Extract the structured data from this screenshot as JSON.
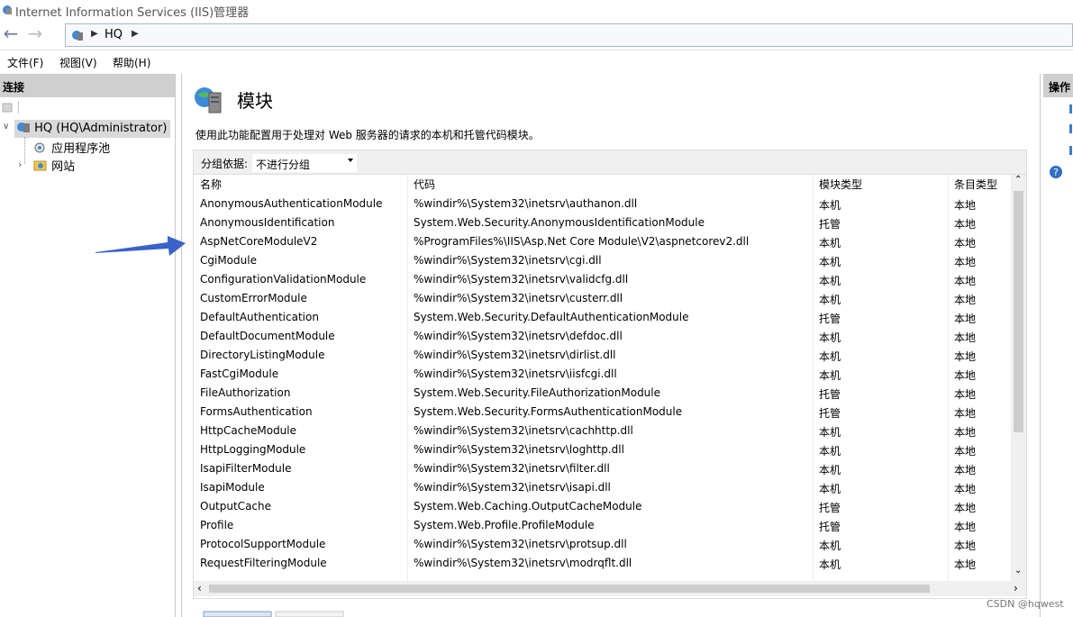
{
  "window": {
    "title": "Internet Information Services (IIS)管理器"
  },
  "address": {
    "crumbs": [
      "HQ"
    ]
  },
  "menu": {
    "items": [
      "文件(F)",
      "视图(V)",
      "帮助(H)"
    ]
  },
  "connections": {
    "header": "连接",
    "root": "HQ (HQ\\Administrator)",
    "children": [
      "应用程序池",
      "网站"
    ]
  },
  "main": {
    "title": "模块",
    "description": "使用此功能配置用于处理对 Web 服务器的请求的本机和托管代码模块。",
    "group_label": "分组依据:",
    "group_value": "不进行分组",
    "columns": [
      "名称",
      "代码",
      "模块类型",
      "条目类型"
    ],
    "rows": [
      [
        "AnonymousAuthenticationModule",
        "%windir%\\System32\\inetsrv\\authanon.dll",
        "本机",
        "本地"
      ],
      [
        "AnonymousIdentification",
        "System.Web.Security.AnonymousIdentificationModule",
        "托管",
        "本地"
      ],
      [
        "AspNetCoreModuleV2",
        "%ProgramFiles%\\IIS\\Asp.Net Core Module\\V2\\aspnetcorev2.dll",
        "本机",
        "本地"
      ],
      [
        "CgiModule",
        "%windir%\\System32\\inetsrv\\cgi.dll",
        "本机",
        "本地"
      ],
      [
        "ConfigurationValidationModule",
        "%windir%\\System32\\inetsrv\\validcfg.dll",
        "本机",
        "本地"
      ],
      [
        "CustomErrorModule",
        "%windir%\\System32\\inetsrv\\custerr.dll",
        "本机",
        "本地"
      ],
      [
        "DefaultAuthentication",
        "System.Web.Security.DefaultAuthenticationModule",
        "托管",
        "本地"
      ],
      [
        "DefaultDocumentModule",
        "%windir%\\System32\\inetsrv\\defdoc.dll",
        "本机",
        "本地"
      ],
      [
        "DirectoryListingModule",
        "%windir%\\System32\\inetsrv\\dirlist.dll",
        "本机",
        "本地"
      ],
      [
        "FastCgiModule",
        "%windir%\\System32\\inetsrv\\iisfcgi.dll",
        "本机",
        "本地"
      ],
      [
        "FileAuthorization",
        "System.Web.Security.FileAuthorizationModule",
        "托管",
        "本地"
      ],
      [
        "FormsAuthentication",
        "System.Web.Security.FormsAuthenticationModule",
        "托管",
        "本地"
      ],
      [
        "HttpCacheModule",
        "%windir%\\System32\\inetsrv\\cachhttp.dll",
        "本机",
        "本地"
      ],
      [
        "HttpLoggingModule",
        "%windir%\\System32\\inetsrv\\loghttp.dll",
        "本机",
        "本地"
      ],
      [
        "IsapiFilterModule",
        "%windir%\\System32\\inetsrv\\filter.dll",
        "本机",
        "本地"
      ],
      [
        "IsapiModule",
        "%windir%\\System32\\inetsrv\\isapi.dll",
        "本机",
        "本地"
      ],
      [
        "OutputCache",
        "System.Web.Caching.OutputCacheModule",
        "托管",
        "本地"
      ],
      [
        "Profile",
        "System.Web.Profile.ProfileModule",
        "托管",
        "本地"
      ],
      [
        "ProtocolSupportModule",
        "%windir%\\System32\\inetsrv\\protsup.dll",
        "本机",
        "本地"
      ],
      [
        "RequestFilteringModule",
        "%windir%\\System32\\inetsrv\\modrqflt.dll",
        "本机",
        "本地"
      ]
    ]
  },
  "actions": {
    "header": "操作"
  },
  "watermark": "CSDN @hqwest",
  "colors": {
    "arrow": "#3a62c9",
    "selected_row": "#d9d9d9",
    "pane_header": "#cfcfcf"
  }
}
